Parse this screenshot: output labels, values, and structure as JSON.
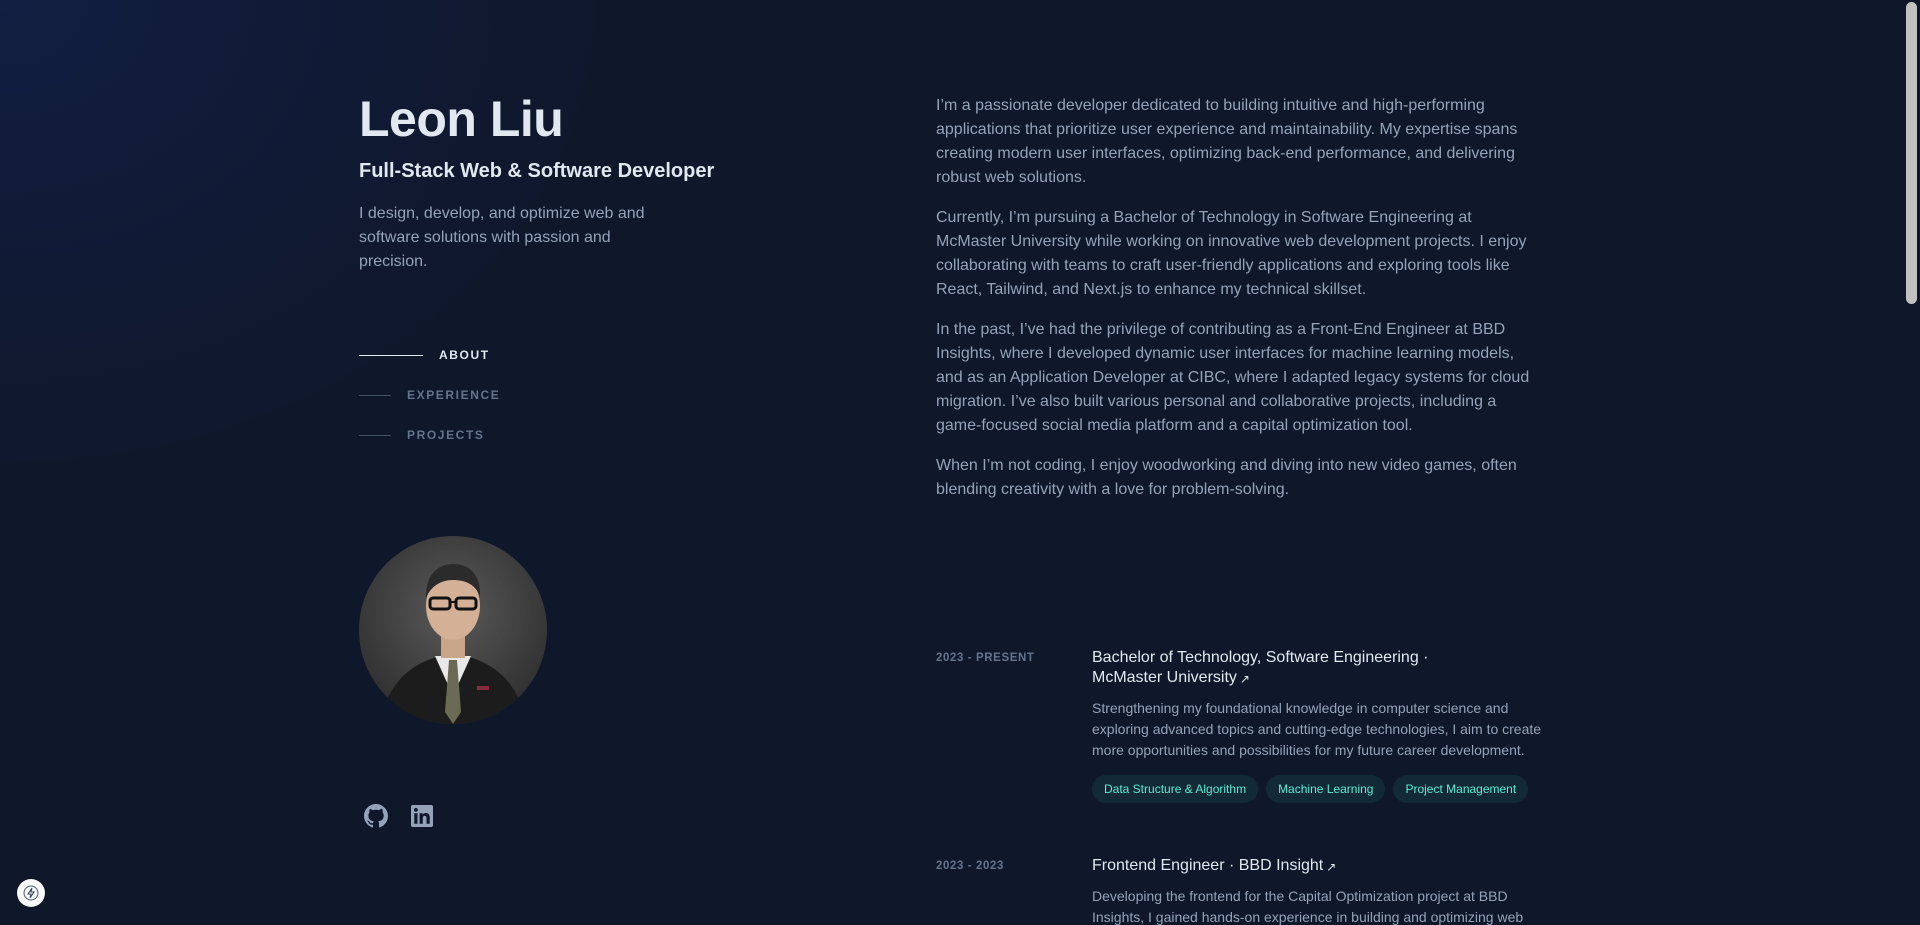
{
  "header": {
    "name": "Leon Liu",
    "role": "Full-Stack Web & Software Developer",
    "tagline": "I design, develop, and optimize web and software solutions with passion and precision."
  },
  "nav": {
    "items": [
      {
        "label": "ABOUT",
        "active": true
      },
      {
        "label": "EXPERIENCE",
        "active": false
      },
      {
        "label": "PROJECTS",
        "active": false
      }
    ]
  },
  "socials": {
    "github_icon": "github-icon",
    "linkedin_icon": "linkedin-icon"
  },
  "about": {
    "paragraphs": [
      "I’m a passionate developer dedicated to building intuitive and high-performing applications that prioritize user experience and maintainability. My expertise spans creating modern user interfaces, optimizing back-end performance, and delivering robust web solutions.",
      "Currently, I’m pursuing a Bachelor of Technology in Software Engineering at McMaster University while working on innovative web development projects. I enjoy collaborating with teams to craft user-friendly applications and exploring tools like React, Tailwind, and Next.js to enhance my technical skillset.",
      "In the past, I’ve had the privilege of contributing as a Front-End Engineer at BBD Insights, where I developed dynamic user interfaces for machine learning models, and as an Application Developer at CIBC, where I adapted legacy systems for cloud migration. I’ve also built various personal and collaborative projects, including a game-focused social media platform and a capital optimization tool.",
      "When I’m not coding, I enjoy woodworking and diving into new video games, often blending creativity with a love for problem-solving."
    ]
  },
  "experience": [
    {
      "date": "2023 - PRESENT",
      "title_line1": "Bachelor of Technology, Software Engineering ·",
      "title_line2": "McMaster University",
      "description": "Strengthening my foundational knowledge in computer science and exploring advanced topics and cutting-edge technologies, I aim to create more opportunities and possibilities for my future career development.",
      "tags": [
        "Data Structure & Algorithm",
        "Machine Learning",
        "Project Management"
      ]
    },
    {
      "date": "2023 - 2023",
      "title": "Frontend Engineer · BBD Insight",
      "description": "Developing the frontend for the Capital Optimization project at BBD Insights, I gained hands-on experience in building and optimizing web"
    }
  ],
  "colors": {
    "background": "#0f172a",
    "heading": "#e2e8f0",
    "body": "#94a3b8",
    "muted": "#64748b",
    "accent": "#5eead4"
  }
}
